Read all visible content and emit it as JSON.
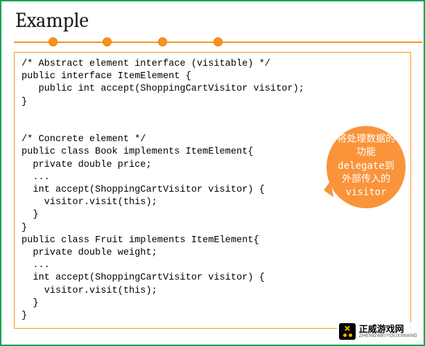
{
  "title": "Example",
  "rulerDots": [
    50,
    128,
    208,
    288
  ],
  "code": "/* Abstract element interface (visitable) */\npublic interface ItemElement {\n   public int accept(ShoppingCartVisitor visitor);\n}\n\n\n/* Concrete element */\npublic class Book implements ItemElement{\n  private double price;\n  ...\n  int accept(ShoppingCartVisitor visitor) {\n    visitor.visit(this);\n  }\n}\npublic class Fruit implements ItemElement{\n  private double weight;\n  ...\n  int accept(ShoppingCartVisitor visitor) {\n    visitor.visit(this);\n  }\n}",
  "callout": {
    "line1": "将处理数据的",
    "line2": "功能",
    "line3": "delegate到",
    "line4": "外部传入的",
    "line5": "visitor"
  },
  "watermark": {
    "main": "正威游戏网",
    "sub": "ZHENGWEIYOUXIWANG"
  }
}
